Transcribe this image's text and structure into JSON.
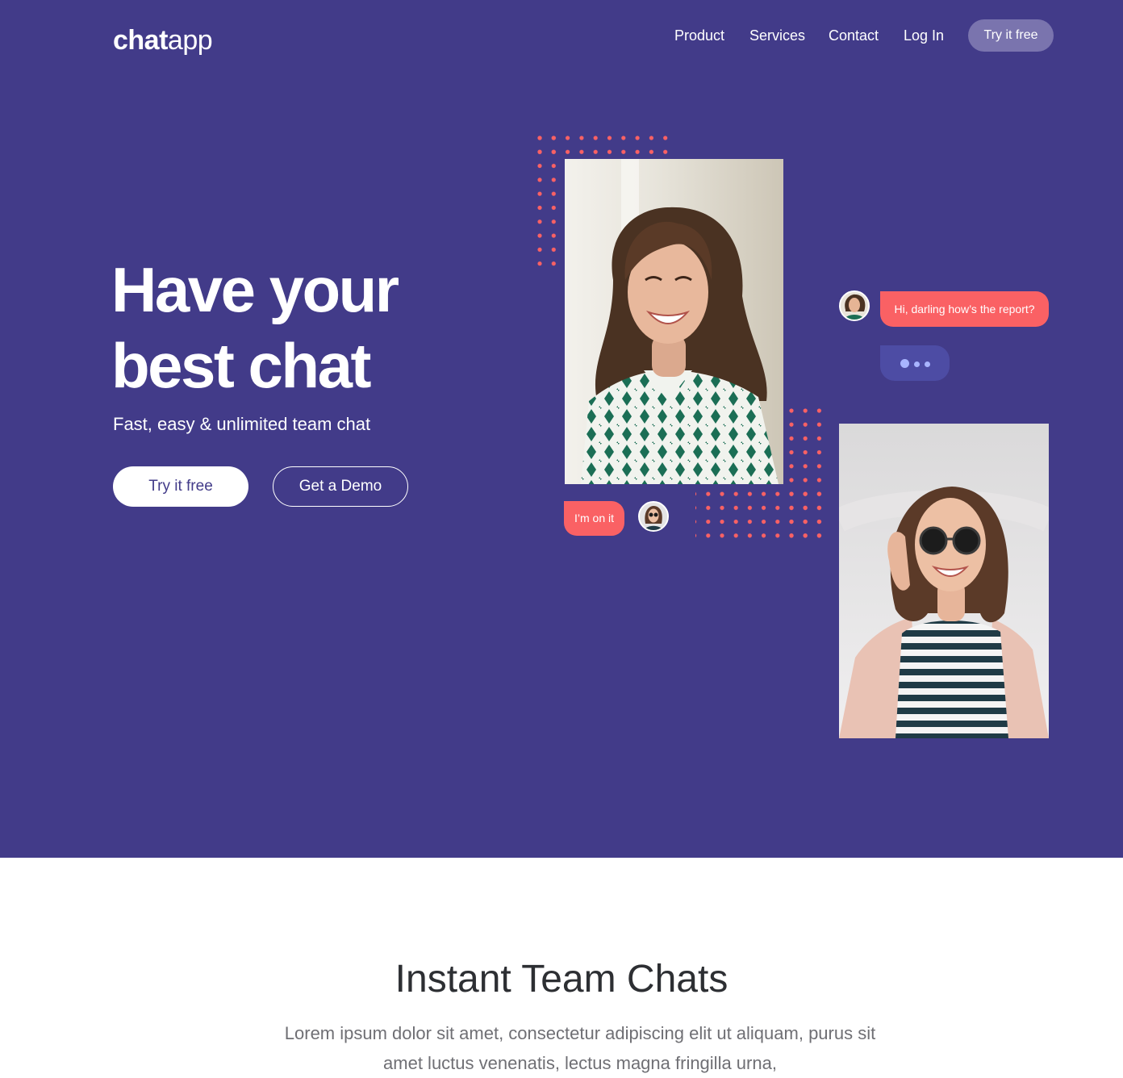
{
  "brand": {
    "bold": "chat",
    "light": "app"
  },
  "nav": {
    "items": [
      "Product",
      "Services",
      "Contact",
      "Log In"
    ],
    "cta": "Try it free"
  },
  "hero": {
    "headline_line1": "Have your",
    "headline_line2": "best chat",
    "subheadline": "Fast, easy & unlimited team chat",
    "primary_button": "Try it free",
    "secondary_button": "Get a Demo"
  },
  "chat": {
    "message_1": "Hi, darling how’s the report?",
    "message_2": "I’m on it"
  },
  "section": {
    "title": "Instant Team Chats",
    "body": "Lorem ipsum dolor sit amet, consectetur adipiscing elit ut aliquam, purus sit amet luctus venenatis, lectus magna fringilla urna,"
  },
  "colors": {
    "hero_bg": "#423b89",
    "accent_coral": "#fa6164",
    "typing_bubble": "#4d4ca4",
    "nav_cta_bg": "#7a74ae"
  }
}
